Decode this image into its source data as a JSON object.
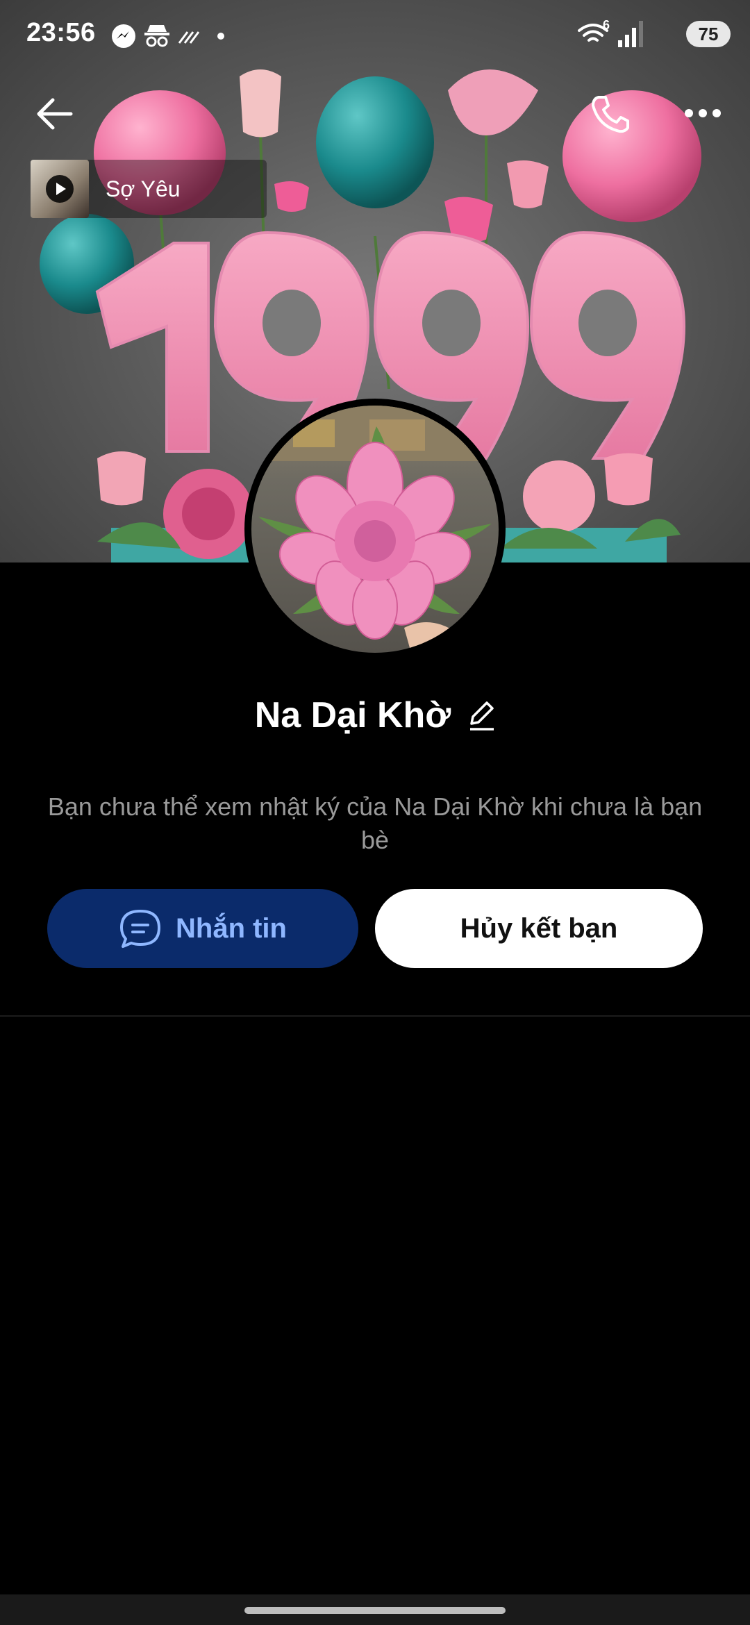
{
  "status_bar": {
    "time": "23:56",
    "icons_left": [
      "messenger-icon",
      "incognito-icon",
      "stripes-icon",
      "dot-icon"
    ],
    "icons_right": [
      "wifi-icon",
      "signal-icon"
    ],
    "wifi_badge": "6",
    "battery": "75"
  },
  "cover": {
    "text": "1999",
    "colors": {
      "pink": "#ee6fa0",
      "teal": "#1a8a8c",
      "background": "#5c5c5c"
    }
  },
  "header": {
    "back_icon": "arrow-left-icon",
    "call_icon": "phone-icon",
    "more_icon": "more-horizontal-icon"
  },
  "music": {
    "title": "Sợ Yêu",
    "icon": "play-icon"
  },
  "profile": {
    "name": "Na Dại Khờ",
    "edit_icon": "pencil-icon",
    "note": "Bạn chưa thể xem nhật ký của Na Dại Khờ khi chưa là bạn bè"
  },
  "actions": {
    "message_label": "Nhắn tin",
    "message_icon": "chat-bubble-icon",
    "unfriend_label": "Hủy kết bạn"
  },
  "colors": {
    "message_bg": "#0b2b6b",
    "message_text": "#8fb7ff",
    "unfriend_bg": "#ffffff",
    "page_bg": "#000000"
  }
}
